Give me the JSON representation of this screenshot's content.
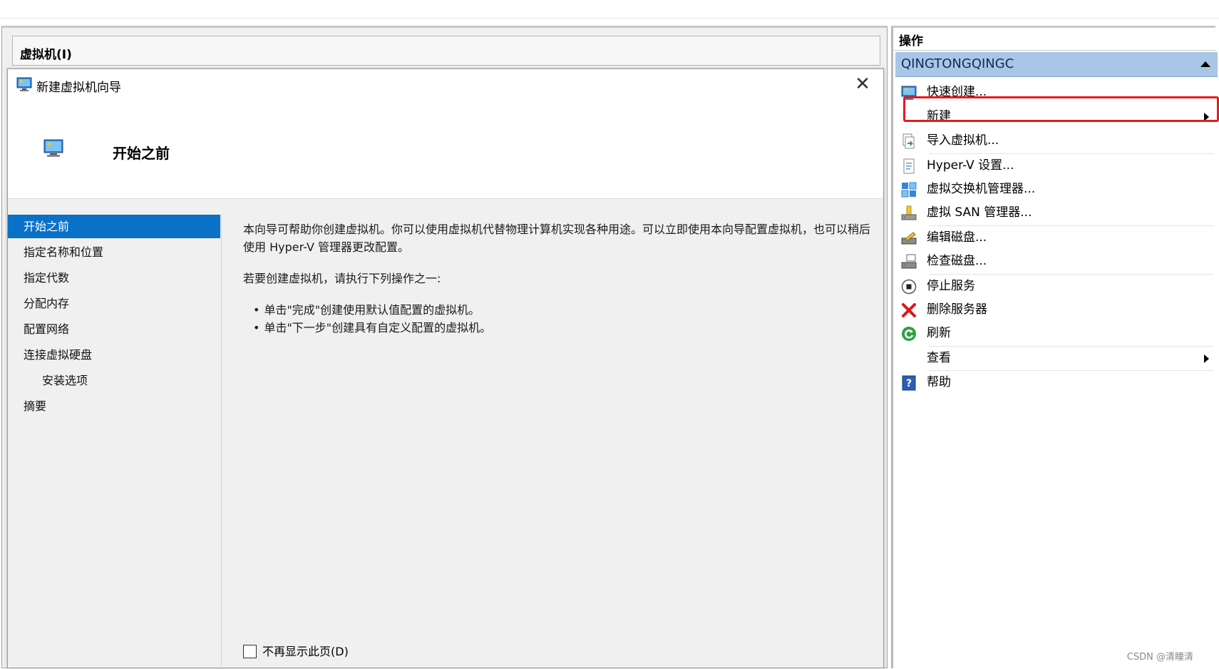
{
  "vm_panel": {
    "title": "虚拟机(I)"
  },
  "dialog": {
    "title": "新建虚拟机向导",
    "close_icon": "close-icon",
    "page_heading": "开始之前",
    "steps": [
      {
        "label": "开始之前",
        "active": true
      },
      {
        "label": "指定名称和位置"
      },
      {
        "label": "指定代数"
      },
      {
        "label": "分配内存"
      },
      {
        "label": "配置网络"
      },
      {
        "label": "连接虚拟硬盘"
      },
      {
        "label": "安装选项",
        "indent": true
      },
      {
        "label": "摘要"
      }
    ],
    "content": {
      "paragraph1": "本向导可帮助你创建虚拟机。你可以使用虚拟机代替物理计算机实现各种用途。可以立即使用本向导配置虚拟机，也可以稍后使用 Hyper-V 管理器更改配置。",
      "paragraph2": "若要创建虚拟机，请执行下列操作之一:",
      "bullets": [
        "单击\"完成\"创建使用默认值配置的虚拟机。",
        "单击\"下一步\"创建具有自定义配置的虚拟机。"
      ]
    },
    "dont_show_checkbox": {
      "label": "不再显示此页(D)",
      "checked": false
    }
  },
  "actions": {
    "title": "操作",
    "server": "QINGTONGQINGC",
    "items": [
      {
        "label": "快速创建...",
        "icon": "quick-create-icon"
      },
      {
        "label": "新建",
        "icon": "",
        "submenu": true,
        "highlighted": true
      },
      {
        "label": "导入虚拟机...",
        "icon": "import-icon"
      },
      {
        "label": "Hyper-V 设置...",
        "icon": "settings-icon"
      },
      {
        "label": "虚拟交换机管理器...",
        "icon": "switch-manager-icon"
      },
      {
        "label": "虚拟 SAN 管理器...",
        "icon": "san-manager-icon"
      },
      {
        "label": "编辑磁盘...",
        "icon": "edit-disk-icon"
      },
      {
        "label": "检查磁盘...",
        "icon": "inspect-disk-icon"
      },
      {
        "label": "停止服务",
        "icon": "stop-icon"
      },
      {
        "label": "删除服务器",
        "icon": "delete-icon"
      },
      {
        "label": "刷新",
        "icon": "refresh-icon"
      },
      {
        "label": "查看",
        "icon": "",
        "submenu": true
      },
      {
        "label": "帮助",
        "icon": "help-icon"
      }
    ]
  },
  "colors": {
    "accent": "#0a71c8",
    "server_bar": "#a9c6e6",
    "highlight_box": "#e8191f"
  },
  "watermark": "CSDN @清瞳清"
}
